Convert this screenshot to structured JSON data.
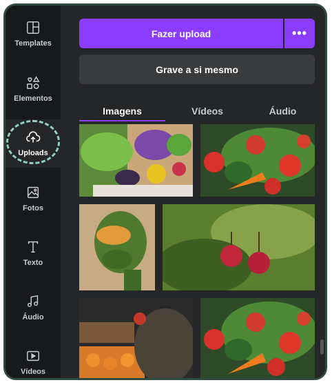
{
  "sidebar": {
    "items": [
      {
        "label": "Templates",
        "icon": "templates-icon"
      },
      {
        "label": "Elementos",
        "icon": "elements-icon"
      },
      {
        "label": "Uploads",
        "icon": "cloud-upload-icon"
      },
      {
        "label": "Fotos",
        "icon": "image-icon"
      },
      {
        "label": "Texto",
        "icon": "text-icon"
      },
      {
        "label": "Áudio",
        "icon": "music-note-icon"
      },
      {
        "label": "Vídeos",
        "icon": "video-icon"
      }
    ]
  },
  "actions": {
    "upload_label": "Fazer upload",
    "more_label": "•••",
    "record_label": "Grave a si mesmo"
  },
  "tabs": [
    {
      "label": "Imagens"
    },
    {
      "label": "Vídeos"
    },
    {
      "label": "Áudio"
    }
  ],
  "colors": {
    "accent": "#8b3dff",
    "panel": "#252627",
    "sidebar": "#18191b",
    "highlight_ring": "#8fd1c3",
    "frame": "#2f4a40"
  },
  "images": [
    {
      "subject": "vegetable box"
    },
    {
      "subject": "vegetable basket"
    },
    {
      "subject": "vegetable face art"
    },
    {
      "subject": "raspberries"
    },
    {
      "subject": "market produce"
    },
    {
      "subject": "vegetable basket"
    }
  ]
}
